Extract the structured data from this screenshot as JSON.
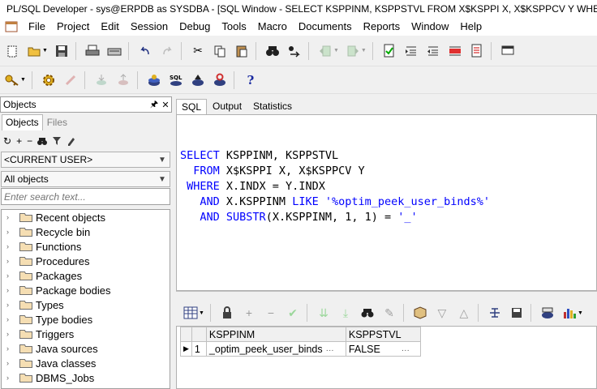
{
  "window": {
    "title": "PL/SQL Developer - sys@ERPDB as SYSDBA - [SQL Window - SELECT KSPPINM, KSPPSTVL FROM X$KSPPI X, X$KSPPCV Y WHERE"
  },
  "menu": [
    "File",
    "Project",
    "Edit",
    "Session",
    "Debug",
    "Tools",
    "Macro",
    "Documents",
    "Reports",
    "Window",
    "Help"
  ],
  "objects_panel": {
    "title": "Objects",
    "tabs": [
      "Objects",
      "Files"
    ],
    "user_combo": "<CURRENT USER>",
    "filter_combo": "All objects",
    "search_placeholder": "Enter search text...",
    "tree": [
      "Recent objects",
      "Recycle bin",
      "Functions",
      "Procedures",
      "Packages",
      "Package bodies",
      "Types",
      "Type bodies",
      "Triggers",
      "Java sources",
      "Java classes",
      "DBMS_Jobs"
    ]
  },
  "sql_tabs": [
    "SQL",
    "Output",
    "Statistics"
  ],
  "sql_text": {
    "l1_kw": "SELECT",
    "l1_rest": " KSPPINM, KSPPSTVL",
    "l2_kw": "  FROM",
    "l2_rest": " X$KSPPI X, X$KSPPCV Y",
    "l3_kw": " WHERE",
    "l3_rest": " X.INDX = Y.INDX",
    "l4_kw": "   AND",
    "l4_mid": " X.KSPPINM ",
    "l4_kw2": "LIKE",
    "l4_str": " '%optim_peek_user_binds%'",
    "l5_kw": "   AND",
    "l5_fn": " SUBSTR",
    "l5_rest": "(X.KSPPINM, 1, 1) = ",
    "l5_str": "'_'"
  },
  "result": {
    "columns": [
      "KSPPINM",
      "KSPPSTVL"
    ],
    "rows": [
      {
        "num": "1",
        "ksppinm": "_optim_peek_user_binds",
        "ksppstvl": "FALSE"
      }
    ]
  },
  "icons": {
    "toolbar1": [
      "new-icon",
      "open-icon",
      "save-icon",
      "print-icon",
      "print-preview-icon",
      "undo-icon",
      "redo-icon",
      "cut-icon",
      "copy-icon",
      "paste-icon",
      "find-icon",
      "find-next-icon",
      "back-icon",
      "forward-icon",
      "compile-icon",
      "indent-icon",
      "unindent-icon",
      "comment-icon",
      "uncomment-icon",
      "window-list-icon"
    ],
    "toolbar2": [
      "key-icon",
      "gear-icon",
      "break-icon",
      "commit-icon",
      "rollback-icon",
      "session-icon",
      "sql-icon",
      "explain-icon",
      "refresh-icon",
      "help-icon"
    ]
  },
  "colors": {
    "sql_keyword": "#0000ff",
    "selection": "#0078d7"
  }
}
